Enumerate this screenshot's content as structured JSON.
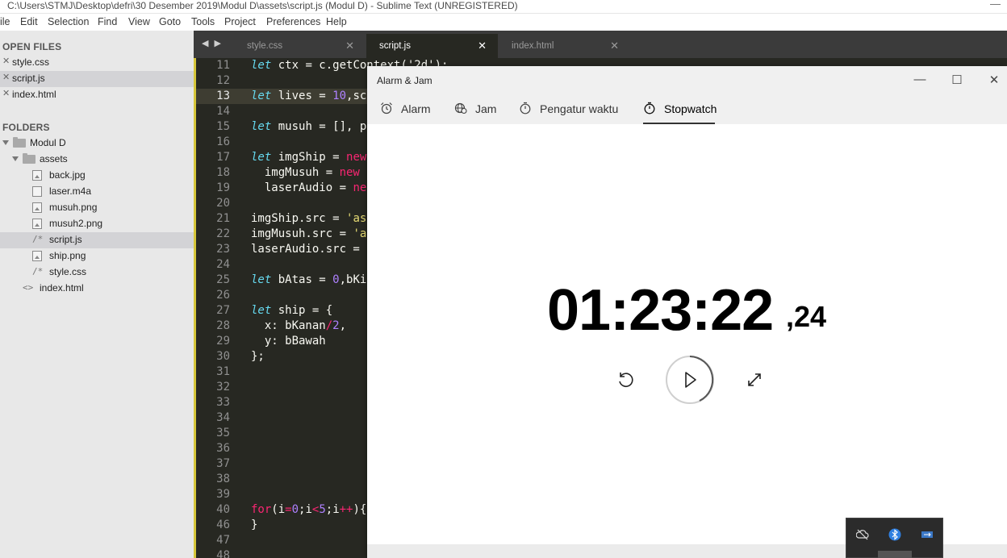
{
  "sublime": {
    "title": "C:\\Users\\STMJ\\Desktop\\defri\\30 Desember 2019\\Modul D\\assets\\script.js (Modul D) - Sublime Text (UNREGISTERED)",
    "menu": [
      "ile",
      "Edit",
      "Selection",
      "Find",
      "View",
      "Goto",
      "Tools",
      "Project",
      "Preferences",
      "Help"
    ],
    "sidebar": {
      "open_files_header": "OPEN FILES",
      "open_files": [
        "style.css",
        "script.js",
        "index.html"
      ],
      "folders_header": "FOLDERS",
      "root_folder": "Modul D",
      "sub_folder": "assets",
      "files": [
        "back.jpg",
        "laser.m4a",
        "musuh.png",
        "musuh2.png",
        "script.js",
        "ship.png",
        "style.css"
      ],
      "root_files": [
        "index.html"
      ]
    },
    "tabs": [
      {
        "label": "style.css",
        "active": false
      },
      {
        "label": "script.js",
        "active": true
      },
      {
        "label": "index.html",
        "active": false
      }
    ],
    "line_numbers": [
      "11",
      "12",
      "13",
      "14",
      "15",
      "16",
      "17",
      "18",
      "19",
      "20",
      "21",
      "22",
      "23",
      "24",
      "25",
      "26",
      "27",
      "28",
      "29",
      "30",
      "31",
      "32",
      "33",
      "34",
      "35",
      "36",
      "37",
      "38",
      "39",
      "40",
      "46",
      "47",
      "48"
    ],
    "code_fragments": {
      "l11_a": "let",
      "l11_b": " ctx = c.getContext('2d');",
      "l13_a": "let",
      "l13_b": " lives = ",
      "l13_c": "10",
      "l13_d": ",sc",
      "l15_a": "let",
      "l15_b": " musuh = [], p",
      "l17_a": "let",
      "l17_b": " imgShip = ",
      "l17_c": "new",
      "l18_a": "  imgMusuh = ",
      "l18_b": "new",
      "l19_a": "  laserAudio = ",
      "l19_b": "ne",
      "l21_a": "imgShip.src = ",
      "l21_b": "'as",
      "l22_a": "imgMusuh.src = ",
      "l22_b": "'a",
      "l23_a": "laserAudio.src = ",
      "l25_a": "let",
      "l25_b": " bAtas = ",
      "l25_c": "0",
      "l25_d": ",bKi",
      "l27_a": "let",
      "l27_b": " ship = {",
      "l28_a": "  x: bKanan",
      "l28_b": "/",
      "l28_c": "2",
      "l28_d": ",",
      "l29_a": "  y: bBawah",
      "l30_a": "};",
      "l40_a": "for",
      "l40_b": "(i",
      "l40_c": "=",
      "l40_d": "0",
      "l40_e": ";i",
      "l40_f": "<",
      "l40_g": "5",
      "l40_h": ";i",
      "l40_i": "++",
      "l40_j": "){",
      "l46_a": "}"
    }
  },
  "alarm_app": {
    "title": "Alarm & Jam",
    "nav": [
      {
        "label": "Alarm",
        "icon": "alarm-clock-icon"
      },
      {
        "label": "Jam",
        "icon": "world-clock-icon"
      },
      {
        "label": "Pengatur waktu",
        "icon": "timer-icon"
      },
      {
        "label": "Stopwatch",
        "icon": "stopwatch-icon",
        "active": true
      }
    ],
    "stopwatch": {
      "time": "01:23:22",
      "hundredths": ",24"
    }
  }
}
